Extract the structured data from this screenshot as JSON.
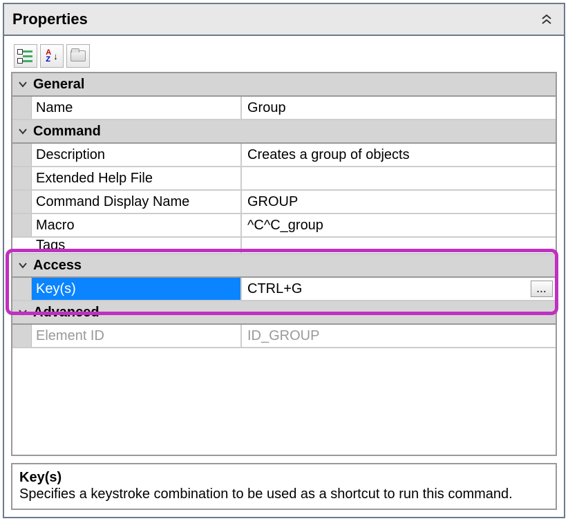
{
  "panel": {
    "title": "Properties"
  },
  "groups": {
    "general": {
      "label": "General",
      "rows": {
        "name": {
          "label": "Name",
          "value": "Group"
        }
      }
    },
    "command": {
      "label": "Command",
      "rows": {
        "description": {
          "label": "Description",
          "value": "Creates a group of objects"
        },
        "ext_help": {
          "label": "Extended Help File",
          "value": ""
        },
        "display_name": {
          "label": "Command Display Name",
          "value": "GROUP"
        },
        "macro": {
          "label": "Macro",
          "value": "^C^C_group"
        },
        "tags": {
          "label": "Tags",
          "value": ""
        }
      }
    },
    "access": {
      "label": "Access",
      "rows": {
        "keys": {
          "label": "Key(s)",
          "value": "CTRL+G",
          "ellipsis": "..."
        }
      }
    },
    "advanced": {
      "label": "Advanced",
      "rows": {
        "element_id": {
          "label": "Element ID",
          "value": "ID_GROUP"
        }
      }
    }
  },
  "description": {
    "title": "Key(s)",
    "text": "Specifies a keystroke combination to be used as a shortcut to run this command."
  }
}
